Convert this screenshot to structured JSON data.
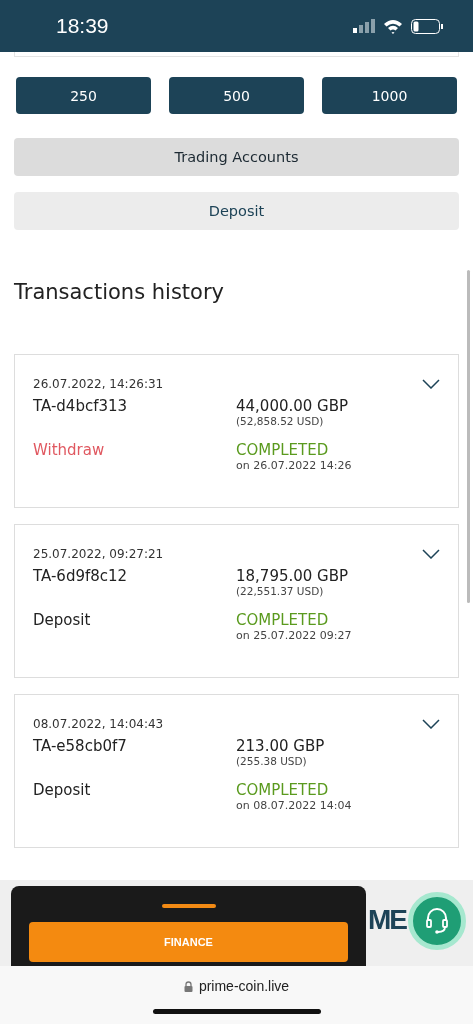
{
  "status_bar": {
    "time": "18:39"
  },
  "amount_buttons": [
    "250",
    "500",
    "1000"
  ],
  "trading_accounts_button": "Trading Accounts",
  "deposit_button": "Deposit",
  "section_title": "Transactions history",
  "transactions": [
    {
      "datetime": "26.07.2022, 14:26:31",
      "id": "TA-d4bcf313",
      "amount": "44,000.00 GBP",
      "converted": "(52,858.52 USD)",
      "kind": "withdraw",
      "type_label": "Withdraw",
      "status": "COMPLETED",
      "status_date": "on 26.07.2022 14:26",
      "expanded": false
    },
    {
      "datetime": "25.07.2022, 09:27:21",
      "id": "TA-6d9f8c12",
      "amount": "18,795.00 GBP",
      "converted": "(22,551.37 USD)",
      "kind": "deposit",
      "type_label": "Deposit",
      "status": "COMPLETED",
      "status_date": "on 25.07.2022 09:27",
      "expanded": false
    },
    {
      "datetime": "08.07.2022, 14:04:43",
      "id": "TA-e58cb0f7",
      "amount": "213.00 GBP",
      "converted": "(255.38 USD)",
      "kind": "deposit",
      "type_label": "Deposit",
      "status": "COMPLETED",
      "status_date": "on 08.07.2022 14:04",
      "expanded": false
    }
  ],
  "logo_fragment": "ME",
  "finance_button": "FINANCE",
  "url": "prime-coin.live"
}
